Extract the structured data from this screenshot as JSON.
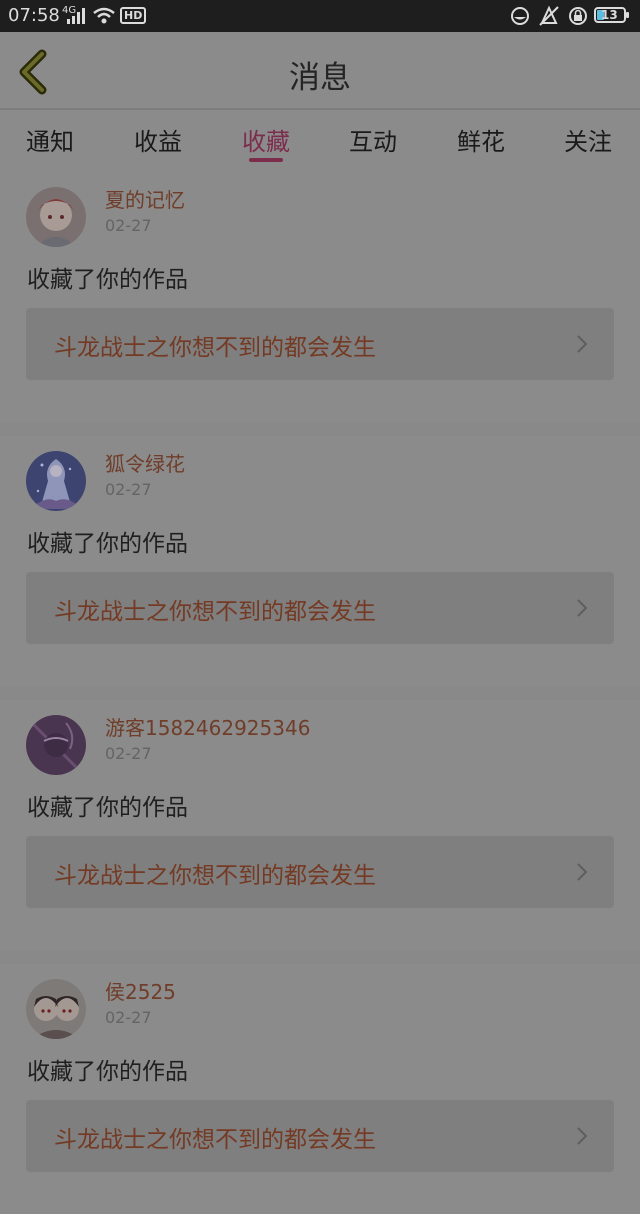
{
  "status_bar": {
    "time": "07:58",
    "network": "4G",
    "hd": "HD",
    "battery": "13"
  },
  "header": {
    "title": "消息"
  },
  "tabs": [
    {
      "label": "通知",
      "active": false
    },
    {
      "label": "收益",
      "active": false
    },
    {
      "label": "收藏",
      "active": true
    },
    {
      "label": "互动",
      "active": false
    },
    {
      "label": "鲜花",
      "active": false
    },
    {
      "label": "关注",
      "active": false
    }
  ],
  "messages": [
    {
      "user": "夏的记忆",
      "date": "02-27",
      "text": "收藏了你的作品",
      "work": "斗龙战士之你想不到的都会发生"
    },
    {
      "user": "狐令绿花",
      "date": "02-27",
      "text": "收藏了你的作品",
      "work": "斗龙战士之你想不到的都会发生"
    },
    {
      "user": "游客1582462925346",
      "date": "02-27",
      "text": "收藏了你的作品",
      "work": "斗龙战士之你想不到的都会发生"
    },
    {
      "user": "侯2525",
      "date": "02-27",
      "text": "收藏了你的作品",
      "work": "斗龙战士之你想不到的都会发生"
    }
  ],
  "colors": {
    "accent": "#7c2d4c",
    "username": "#6f3d29",
    "work_title": "#743a23"
  }
}
